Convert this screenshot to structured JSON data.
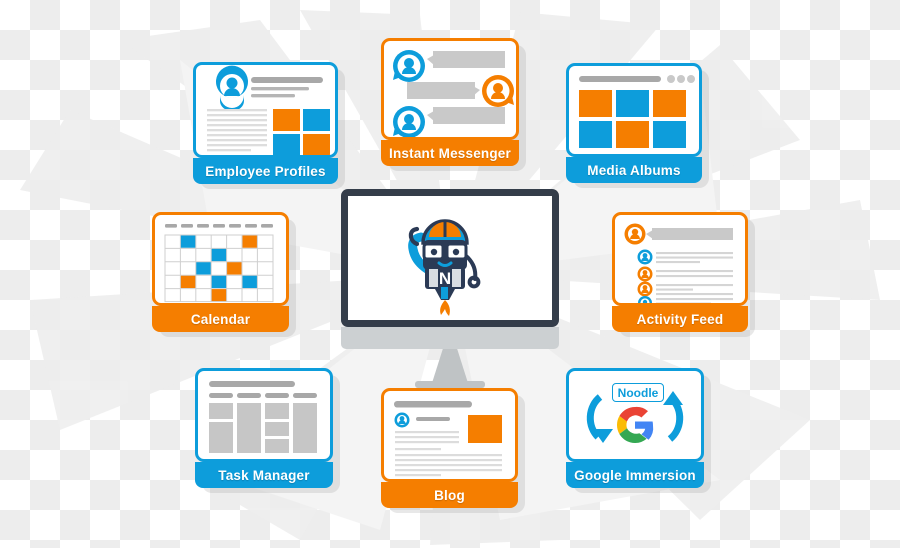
{
  "theme": {
    "blue": "#0d9ddb",
    "orange": "#f57e00",
    "grey": "#c9c9c9",
    "dark": "#343d4a",
    "white": "#ffffff"
  },
  "center": {
    "device_name": "desktop-monitor",
    "mascot_name": "noodle-rocket-mascot",
    "mascot_badge_letter": "N"
  },
  "cards": [
    {
      "id": "employee-profiles",
      "label": "Employee Profiles",
      "accent": "blue",
      "icon": "user-profile-icon"
    },
    {
      "id": "instant-messenger",
      "label": "Instant Messenger",
      "accent": "orange",
      "icon": "chat-bubbles-icon"
    },
    {
      "id": "media-albums",
      "label": "Media Albums",
      "accent": "blue",
      "icon": "photo-grid-icon"
    },
    {
      "id": "calendar",
      "label": "Calendar",
      "accent": "orange",
      "icon": "calendar-grid-icon"
    },
    {
      "id": "activity-feed",
      "label": "Activity Feed",
      "accent": "orange",
      "icon": "feed-list-icon"
    },
    {
      "id": "task-manager",
      "label": "Task Manager",
      "accent": "blue",
      "icon": "kanban-board-icon"
    },
    {
      "id": "blog",
      "label": "Blog",
      "accent": "orange",
      "icon": "article-icon"
    },
    {
      "id": "google-immersion",
      "label": "Google Immersion",
      "accent": "blue",
      "icon": "sync-arrows-icon",
      "badge_text": "Noodle",
      "logo_name": "google-g-logo",
      "google_colors": [
        "#ea4335",
        "#fbbc05",
        "#34a853",
        "#4285f4"
      ]
    }
  ],
  "calendar_cells": [
    {
      "row": 1,
      "col": 2,
      "color": "blue"
    },
    {
      "row": 1,
      "col": 6,
      "color": "orange"
    },
    {
      "row": 2,
      "col": 4,
      "color": "blue"
    },
    {
      "row": 3,
      "col": 3,
      "color": "blue"
    },
    {
      "row": 3,
      "col": 5,
      "color": "orange"
    },
    {
      "row": 4,
      "col": 2,
      "color": "orange"
    },
    {
      "row": 4,
      "col": 4,
      "color": "blue"
    },
    {
      "row": 4,
      "col": 6,
      "color": "blue"
    },
    {
      "row": 5,
      "col": 4,
      "color": "orange"
    }
  ],
  "media_tiles": [
    "orange",
    "blue",
    "orange",
    "blue",
    "orange",
    "blue"
  ],
  "profile_tiles": [
    "orange",
    "blue",
    "blue",
    "orange"
  ],
  "activity_rows": [
    "blue",
    "orange",
    "orange",
    "blue"
  ]
}
